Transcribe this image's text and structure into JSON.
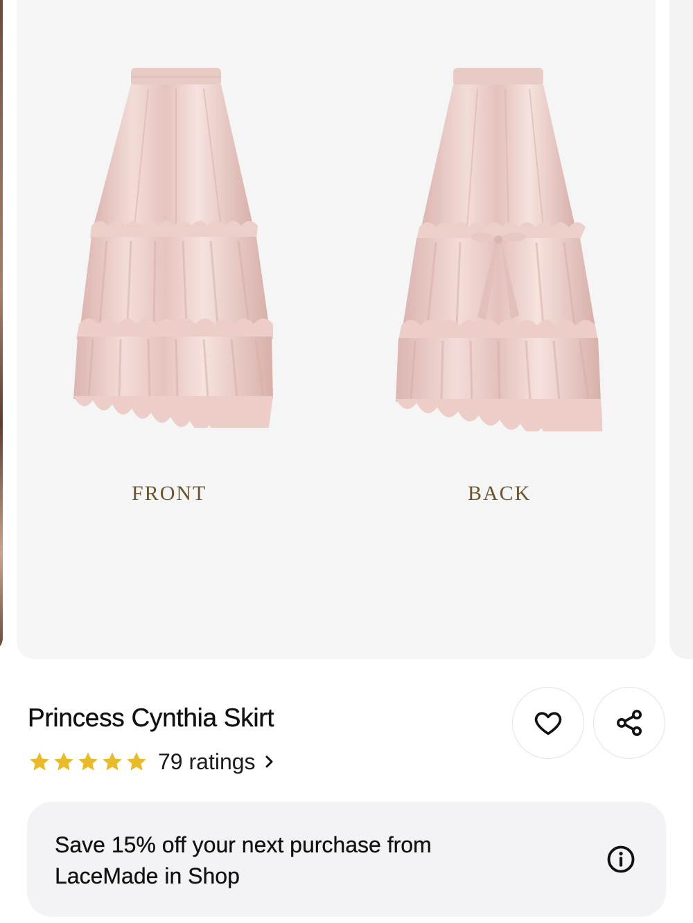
{
  "gallery": {
    "image_alt": "Pink satin tiered ruffle skirt, front and back views",
    "front_label": "FRONT",
    "back_label": "BACK"
  },
  "product": {
    "title": "Princess Cynthia Skirt",
    "rating_stars": 5,
    "ratings_text": "79 ratings"
  },
  "actions": {
    "favorite_icon": "heart-icon",
    "share_icon": "share-icon"
  },
  "promo": {
    "text": "Save 15% off your next purchase from LaceMade  in Shop",
    "icon": "info-icon"
  },
  "colors": {
    "star": "#E9BB2A",
    "skirt": "#EDCDC9",
    "label": "#6B5530"
  }
}
